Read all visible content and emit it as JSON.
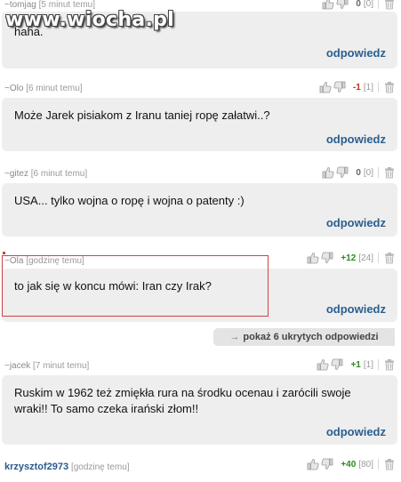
{
  "watermark": {
    "text": "www.wiocha.pl"
  },
  "reply_label": "odpowiedz",
  "hidden_replies": {
    "arrow": "→",
    "label": "pokaż 6 ukrytych odpowiedzi"
  },
  "comments": [
    {
      "author": "~tomjag",
      "time": "[5 minut temu]",
      "score": "0",
      "votes": "[0]",
      "text": "haha."
    },
    {
      "author": "~Olo",
      "time": "[6 minut temu]",
      "score": "-1",
      "votes": "[1]",
      "text": "Może Jarek pisiakom z Iranu taniej ropę załatwi..?"
    },
    {
      "author": "~gitez",
      "time": "[6 minut temu]",
      "score": "0",
      "votes": "[0]",
      "text": "USA... tylko wojna o ropę i wojna o patenty :)"
    },
    {
      "author": "~Ola",
      "time": "[godzinę temu]",
      "score": "+12",
      "votes": "[24]",
      "text": "to jak się w koncu mówi: Iran czy Irak?"
    },
    {
      "author": "~jacek",
      "time": "[7 minut temu]",
      "score": "+1",
      "votes": "[1]",
      "text": "Ruskim w 1962 też zmiękła rura na środku ocenau i zarócili swoje wraki!! To samo czeka irański złom!!"
    },
    {
      "author": "krzysztof2973",
      "time": "[godzinę temu]",
      "score": "+40",
      "votes": "[80]",
      "text": ""
    }
  ],
  "colors": {
    "bubble": "#eeeeee",
    "reply": "#2a5f8f",
    "negative": "#c0301a",
    "positive": "#2a8a1e",
    "highlight_border": "#cc4444"
  },
  "icons": [
    "thumb-up-icon",
    "thumb-down-icon",
    "trash-icon",
    "arrow-right-icon"
  ]
}
